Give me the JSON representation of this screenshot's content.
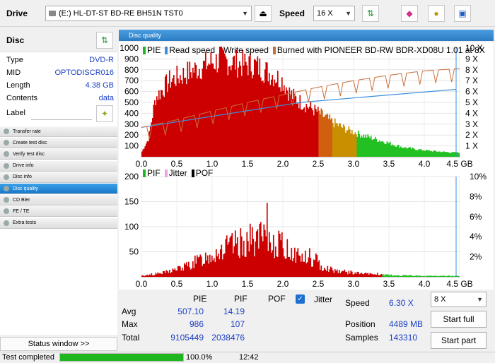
{
  "toolbar": {
    "drive_label": "Drive",
    "drive_value": "(E:)  HL-DT-ST BD-RE  BH51N TST0",
    "speed_label": "Speed",
    "speed_value": "16 X",
    "icons": [
      "drive-icon",
      "eject-icon",
      "refresh-icon",
      "eraser-icon",
      "copy-icon",
      "save-icon"
    ]
  },
  "disc": {
    "title": "Disc",
    "rows": [
      {
        "k": "Type",
        "v": "DVD-R"
      },
      {
        "k": "MID",
        "v": "OPTODISCR016"
      },
      {
        "k": "Length",
        "v": "4.38 GB"
      },
      {
        "k": "Contents",
        "v": "data"
      }
    ],
    "label_key": "Label",
    "label_value": ""
  },
  "menu": [
    {
      "label": "Transfer rate",
      "active": false
    },
    {
      "label": "Create test disc",
      "active": false
    },
    {
      "label": "Verify test disc",
      "active": false
    },
    {
      "label": "Drive info",
      "active": false
    },
    {
      "label": "Disc info",
      "active": false
    },
    {
      "label": "Disc quality",
      "active": true
    },
    {
      "label": "CD Bler",
      "active": false
    },
    {
      "label": "FE / TE",
      "active": false
    },
    {
      "label": "Extra tests",
      "active": false
    }
  ],
  "status_window": "Status window >>",
  "panel_title": "Disc quality",
  "chart_data": [
    {
      "type": "area",
      "legend": [
        "PIE",
        "Read speed",
        "Write speed",
        "Burned with PIONEER BD-RW  BDR-XD08U 1.01 at 8X"
      ],
      "colors": {
        "pie": "#cc0000",
        "read": "#3a8fe0",
        "write": "#c8703c"
      },
      "y_ticks": [
        100,
        200,
        300,
        400,
        500,
        600,
        700,
        800,
        900,
        1000
      ],
      "y2_ticks": [
        "1 X",
        "2 X",
        "3 X",
        "4 X",
        "5 X",
        "6 X",
        "7 X",
        "8 X",
        "9 X",
        "10 X"
      ],
      "x_ticks": [
        "0.0",
        "0.5",
        "1.0",
        "1.5",
        "2.0",
        "2.5",
        "3.0",
        "3.5",
        "4.0",
        "4.5 GB"
      ],
      "ylim": [
        0,
        1000
      ],
      "y2lim": [
        0,
        10
      ],
      "xlim": [
        0,
        4.5
      ],
      "pie_profile": [
        [
          0.0,
          40
        ],
        [
          0.1,
          170
        ],
        [
          0.2,
          560
        ],
        [
          0.4,
          720
        ],
        [
          0.6,
          780
        ],
        [
          0.8,
          840
        ],
        [
          1.0,
          900
        ],
        [
          1.2,
          910
        ],
        [
          1.4,
          880
        ],
        [
          1.6,
          870
        ],
        [
          1.8,
          800
        ],
        [
          2.0,
          720
        ],
        [
          2.1,
          600
        ],
        [
          2.2,
          540
        ],
        [
          2.4,
          460
        ],
        [
          2.5,
          420
        ],
        [
          2.7,
          330
        ],
        [
          2.9,
          260
        ],
        [
          3.1,
          210
        ],
        [
          3.3,
          170
        ],
        [
          3.5,
          130
        ],
        [
          3.7,
          90
        ],
        [
          3.9,
          70
        ],
        [
          4.1,
          55
        ],
        [
          4.3,
          45
        ],
        [
          4.45,
          40
        ]
      ],
      "read_speed": [
        [
          0,
          2.7
        ],
        [
          2.25,
          5.0
        ],
        [
          4.45,
          6.2
        ]
      ],
      "write_speed": [
        [
          0,
          2.7
        ],
        [
          0.5,
          3.4
        ],
        [
          1.0,
          4.2
        ],
        [
          1.5,
          5.0
        ],
        [
          2.0,
          5.7
        ],
        [
          2.5,
          6.4
        ],
        [
          3.0,
          7.0
        ],
        [
          3.5,
          7.5
        ],
        [
          4.0,
          7.9
        ],
        [
          4.45,
          8.1
        ]
      ]
    },
    {
      "type": "area",
      "legend": [
        "PIF",
        "Jitter",
        "POF"
      ],
      "colors": {
        "pif": "#cc0000",
        "jitter": "#e8a8e8",
        "pof": "#000000"
      },
      "y_ticks": [
        50,
        100,
        150,
        200
      ],
      "y2_ticks": [
        "2%",
        "4%",
        "6%",
        "8%",
        "10%"
      ],
      "x_ticks": [
        "0.0",
        "0.5",
        "1.0",
        "1.5",
        "2.0",
        "2.5",
        "3.0",
        "3.5",
        "4.0",
        "4.5 GB"
      ],
      "ylim": [
        0,
        200
      ],
      "xlim": [
        0,
        4.5
      ],
      "pif_profile": [
        [
          0.0,
          2
        ],
        [
          0.3,
          8
        ],
        [
          0.6,
          20
        ],
        [
          0.9,
          40
        ],
        [
          1.1,
          55
        ],
        [
          1.3,
          65
        ],
        [
          1.5,
          75
        ],
        [
          1.7,
          80
        ],
        [
          1.9,
          70
        ],
        [
          2.1,
          55
        ],
        [
          2.3,
          40
        ],
        [
          2.5,
          25
        ],
        [
          2.7,
          15
        ],
        [
          2.9,
          10
        ],
        [
          3.1,
          7
        ],
        [
          3.3,
          5
        ],
        [
          3.6,
          3
        ],
        [
          4.0,
          2
        ],
        [
          4.45,
          2
        ]
      ]
    }
  ],
  "stats": {
    "col_pie": "PIE",
    "col_pif": "PIF",
    "col_pof": "POF",
    "col_jitter": "Jitter",
    "avg_label": "Avg",
    "avg_pie": "507.10",
    "avg_pif": "14.19",
    "max_label": "Max",
    "max_pie": "986",
    "max_pif": "107",
    "total_label": "Total",
    "total_pie": "9105449",
    "total_pif": "2038476",
    "speed_label": "Speed",
    "speed_value": "6.30 X",
    "position_label": "Position",
    "position_value": "4489 MB",
    "samples_label": "Samples",
    "samples_value": "143310",
    "speed_select": "8 X",
    "start_full": "Start full",
    "start_part": "Start part"
  },
  "status": {
    "text": "Test completed",
    "progress": 100,
    "progress_label": "100.0%",
    "time": "12:42"
  }
}
